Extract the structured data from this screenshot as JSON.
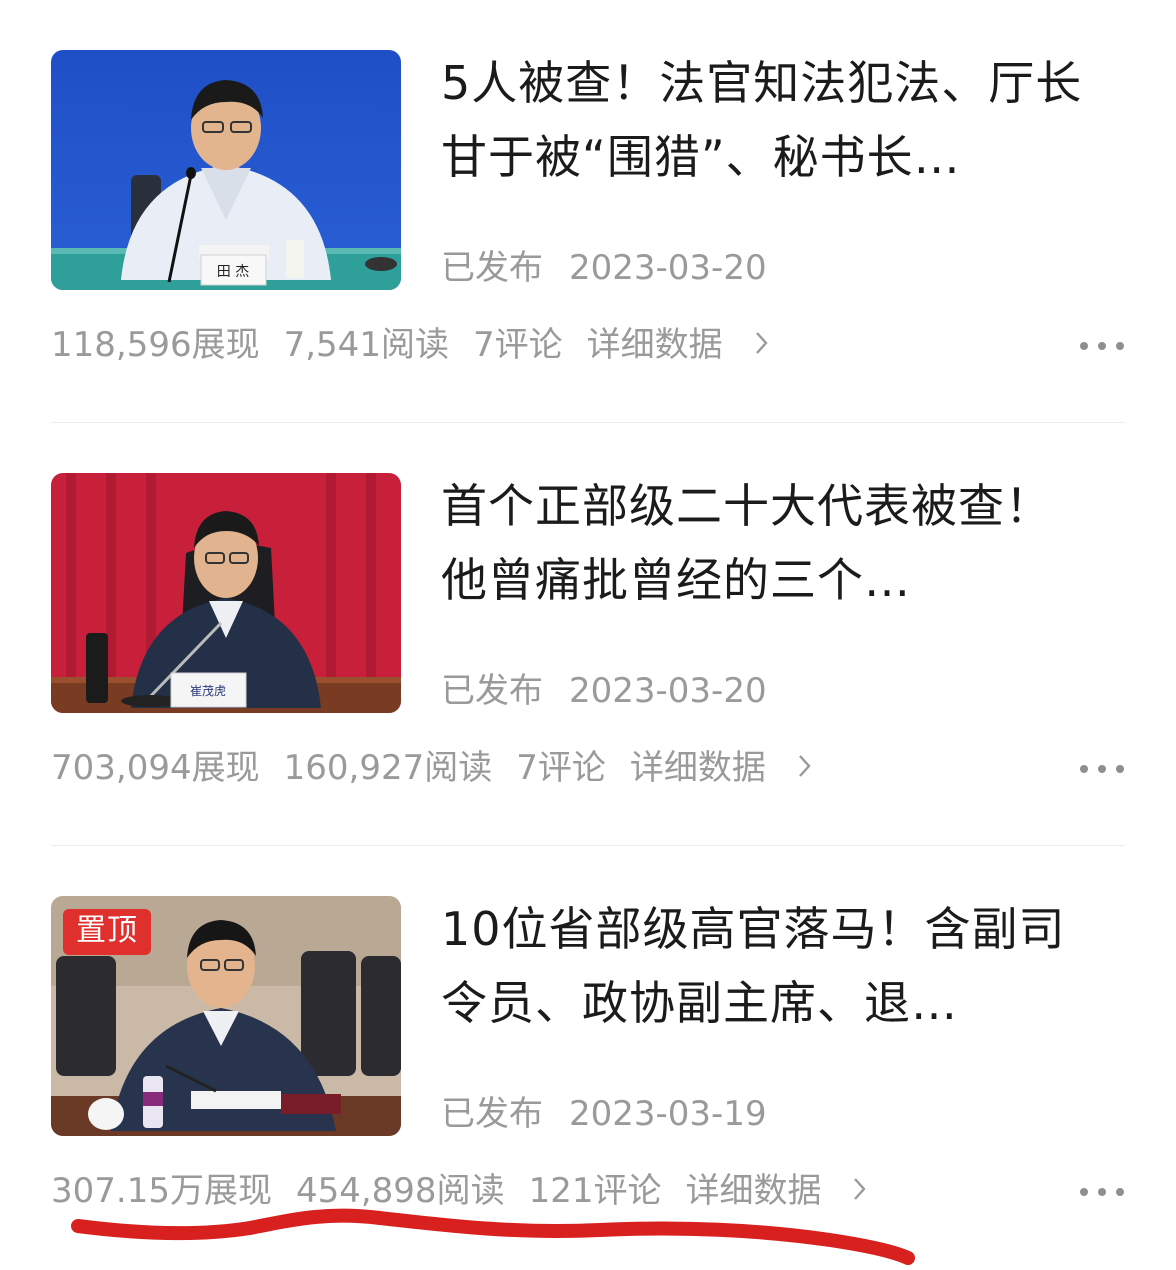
{
  "articles": [
    {
      "title": "5人被查！法官知法犯法、厅长甘于被“围猎”、秘书长…",
      "status": "已发布",
      "date": "2023-03-20",
      "impressions": "118,596展现",
      "reads": "7,541阅读",
      "comments": "7评论",
      "detail_label": "详细数据",
      "nameplate": "田 杰",
      "pinned_label": ""
    },
    {
      "title": "首个正部级二十大代表被查！他曾痛批曾经的三个…",
      "status": "已发布",
      "date": "2023-03-20",
      "impressions": "703,094展现",
      "reads": "160,927阅读",
      "comments": "7评论",
      "detail_label": "详细数据",
      "nameplate": "崔茂虎",
      "pinned_label": ""
    },
    {
      "title": "10位省部级高官落马！含副司令员、政协副主席、退…",
      "status": "已发布",
      "date": "2023-03-19",
      "impressions": "307.15万展现",
      "reads": "454,898阅读",
      "comments": "121评论",
      "detail_label": "详细数据",
      "nameplate": "",
      "pinned_label": "置顶"
    }
  ],
  "icons": {
    "chevron": "chevron-right-icon",
    "more": "more-dots-icon"
  },
  "colors": {
    "title_text": "#1b1b1b",
    "meta_text": "#9a9a9a",
    "pinned_badge": "#e0302e",
    "annotation_stroke": "#d8201f"
  }
}
